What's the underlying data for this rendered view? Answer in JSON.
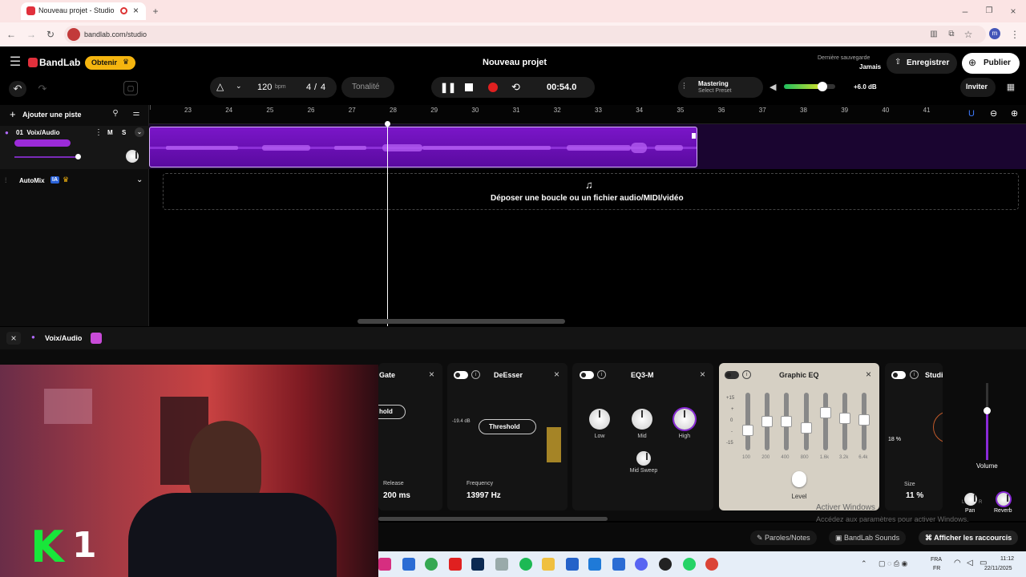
{
  "browser": {
    "tab_title": "Nouveau projet - Studio",
    "url": "bandlab.com/studio",
    "profile_initial": "m"
  },
  "header": {
    "brand": "BandLab",
    "get_button": "Obtenir",
    "project_title": "Nouveau projet",
    "last_save_label": "Dernière sauvegarde",
    "last_save_value": "Jamais",
    "save_button": "Enregistrer",
    "publish_button": "Publier",
    "invite_button": "Inviter"
  },
  "transport": {
    "bpm": "120",
    "bpm_unit": "bpm",
    "time_sig_num": "4",
    "time_sig_sep": "/",
    "time_sig_den": "4",
    "key_label": "Tonalité",
    "time": "00:54.0",
    "mastering_title": "Mastering",
    "mastering_preset": "Select Preset",
    "master_volume": "+6.0 dB",
    "master_level": 0.75
  },
  "tracks_panel": {
    "add_track": "Ajouter une piste",
    "track_name": "01  Voix/Audio",
    "mute": "M",
    "solo": "S",
    "automix": "AutoMix",
    "automix_badge": "IA"
  },
  "ruler": {
    "bars": [
      "23",
      "24",
      "25",
      "26",
      "27",
      "28",
      "29",
      "30",
      "31",
      "32",
      "33",
      "34",
      "35",
      "36",
      "37",
      "38",
      "39",
      "40",
      "41"
    ]
  },
  "arrange": {
    "drop_text": "Déposer une boucle ou un fichier audio/MIDI/vidéo"
  },
  "dock": {
    "track_title": "Voix/Audio",
    "effects": [
      {
        "name": "Gate",
        "param_label": "Release",
        "param_value": "200 ms",
        "dropdown": "hold"
      },
      {
        "name": "DeEsser",
        "param_label": "Frequency",
        "param_value": "13997 Hz",
        "dropdown": "Threshold",
        "db_readout": "-19.4 dB"
      },
      {
        "name": "EQ3-M",
        "knobs": [
          "Low",
          "Mid",
          "High"
        ],
        "sweep": "Mid Sweep"
      },
      {
        "name": "Graphic EQ",
        "db_scale": [
          "+15",
          "+",
          "0",
          "-",
          "-15"
        ],
        "bands": [
          "100",
          "200",
          "400",
          "800",
          "1.6k",
          "3.2k",
          "6.4k"
        ],
        "level_label": "Level"
      },
      {
        "name": "Studi",
        "size_label": "Size",
        "size_value": "11 %",
        "pct": "18 %"
      }
    ],
    "volume_label": "Volume",
    "pan_label": "Pan",
    "reverb_label": "Reverb",
    "pan_l": "L",
    "pan_r": "R"
  },
  "bottombar": {
    "lyrics": "Paroles/Notes",
    "sounds": "BandLab Sounds",
    "shortcuts": "Afficher les raccourcis"
  },
  "overlay": {
    "windows_activate_1": "Activer Windows",
    "windows_activate_2": "Accédez aux paramètres pour activer Windows.",
    "cam_logo_letter": "K",
    "cam_logo_digit": "1"
  },
  "taskbar": {
    "lang_1": "FRA",
    "lang_2": "FR",
    "time": "11:12",
    "date": "22/11/2025"
  },
  "colors": {
    "accent_purple": "#7a16c8",
    "gold": "#f5b50f",
    "record_red": "#e02020"
  }
}
